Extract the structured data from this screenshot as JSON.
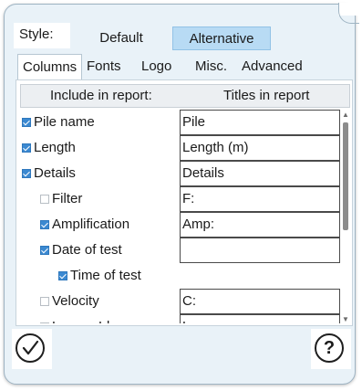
{
  "style": {
    "label": "Style:",
    "options": [
      "Default",
      "Alternative"
    ],
    "selected": "Alternative"
  },
  "tabs": [
    "Columns",
    "Fonts",
    "Logo",
    "Misc.",
    "Advanced"
  ],
  "active_tab": "Columns",
  "table": {
    "header_left": "Include in report:",
    "header_right": "Titles in report",
    "rows": [
      {
        "label": "Pile name",
        "checked": true,
        "title": "Pile"
      },
      {
        "label": "Length",
        "checked": true,
        "title": "Length (m)"
      },
      {
        "label": "Details",
        "checked": true,
        "title": "Details"
      },
      {
        "label": "Filter",
        "checked": false,
        "title": "F:"
      },
      {
        "label": "Amplification",
        "checked": true,
        "title": "Amp:"
      },
      {
        "label": "Date of test",
        "checked": true,
        "title": ""
      },
      {
        "label": "Time of test",
        "checked": true,
        "title": null
      },
      {
        "label": "Velocity",
        "checked": false,
        "title": "C:"
      },
      {
        "label": "Logger Id",
        "checked": false,
        "title": "Logger"
      }
    ]
  },
  "footer": {
    "help_label": "?"
  },
  "colors": {
    "popup_bg": "#e9f2f8",
    "selected_segment": "#b8dbf4",
    "checkbox_on": "#3b89d1"
  },
  "icons": {
    "ok": "checkmark-circle-icon",
    "help": "question-circle-icon",
    "scroll_up": "caret-up-icon",
    "scroll_down": "caret-down-icon"
  }
}
